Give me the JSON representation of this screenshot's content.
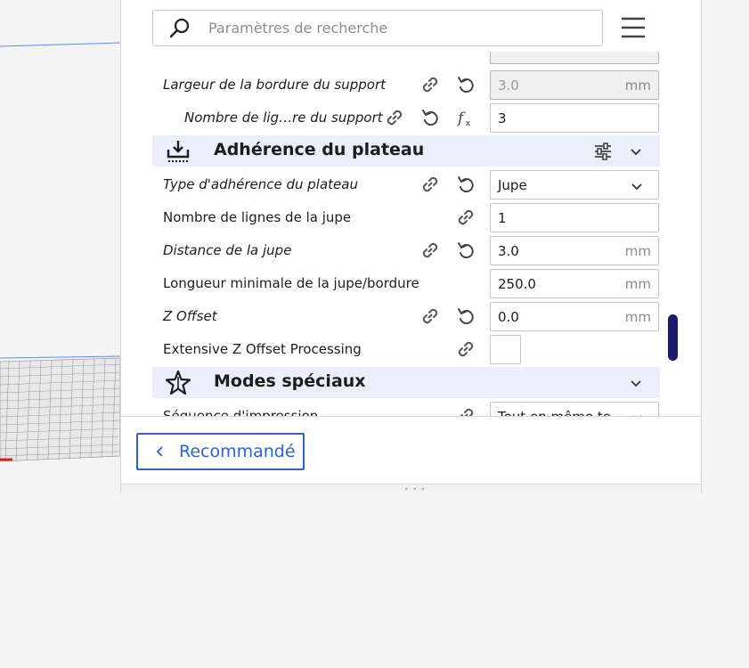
{
  "search": {
    "placeholder": "Paramètres de recherche"
  },
  "settings": {
    "partial_top_value": "",
    "support_brim_width": {
      "label": "Largeur de la bordure du support",
      "value": "3.0",
      "unit": "mm"
    },
    "support_brim_line_count": {
      "label": "Nombre de lig…re du support",
      "value": "3"
    },
    "category_adhesion": {
      "title": "Adhérence du plateau"
    },
    "adhesion_type": {
      "label": "Type d'adhérence du plateau",
      "value": "Jupe"
    },
    "skirt_line_count": {
      "label": "Nombre de lignes de la jupe",
      "value": "1"
    },
    "skirt_distance": {
      "label": "Distance de la jupe",
      "value": "3.0",
      "unit": "mm"
    },
    "skirt_brim_min_length": {
      "label": "Longueur minimale de la jupe/bordure",
      "value": "250.0",
      "unit": "mm"
    },
    "z_offset": {
      "label": "Z Offset",
      "value": "0.0",
      "unit": "mm"
    },
    "extensive_z_offset": {
      "label": "Extensive Z Offset Processing",
      "checked": false
    },
    "category_special": {
      "title": "Modes spéciaux"
    },
    "print_sequence": {
      "label": "Séquence d'impression",
      "value": "Tout en même te"
    }
  },
  "footer": {
    "recommended_label": "Recommandé",
    "grip": "• • •"
  },
  "colors": {
    "accent": "#2a63d4",
    "category_bg": "#e9f0fb",
    "scroll_thumb": "#1b1b6b"
  }
}
